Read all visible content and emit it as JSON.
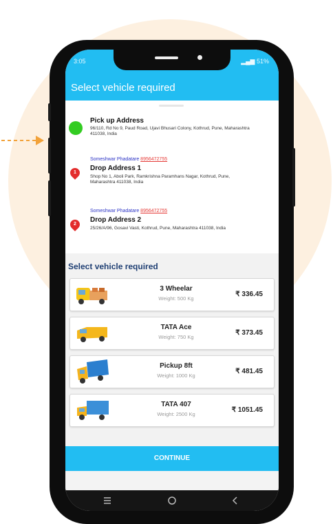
{
  "statusbar": {
    "time": "3:05",
    "battery": "51%"
  },
  "appbar": {
    "title": "Select vehicle required"
  },
  "pickup": {
    "title": "Pick up Address",
    "address": "96/110, Rd No 9, Paud Road, Ujavi Bhusari Colony, Kothrud, Pune, Maharashtra 411038, India"
  },
  "drops": [
    {
      "contact_name": "Someshwar Phadatare",
      "contact_phone": "8956472755",
      "title": "Drop Address 1",
      "address": "Shop No 1, Aboli Park, Ramkrishna Paramhans Nagar, Kothrud, Pune, Maharashtra 411038, India",
      "marker": "1"
    },
    {
      "contact_name": "Someshwar Phadatare",
      "contact_phone": "8956472755",
      "title": "Drop Address 2",
      "address": "25/26/A/96, Gosavi Vasti, Kothrud, Pune, Maharashtra 411038, India",
      "marker": "2"
    }
  ],
  "vehicles_section": {
    "title": "Select vehicle required",
    "vehicles": [
      {
        "name": "3 Wheelar",
        "weight": "Weight: 500 Kg",
        "price": "₹ 336.45",
        "icon": "auto-rickshaw-icon"
      },
      {
        "name": "TATA Ace",
        "weight": "Weight: 750 Kg",
        "price": "₹ 373.45",
        "icon": "mini-truck-icon"
      },
      {
        "name": "Pickup 8ft",
        "weight": "Weight: 1000 Kg",
        "price": "₹ 481.45",
        "icon": "pickup-truck-icon"
      },
      {
        "name": "TATA 407",
        "weight": "Weight: 2500 Kg",
        "price": "₹ 1051.45",
        "icon": "truck-icon"
      }
    ]
  },
  "continue_button": {
    "label": "CONTINUE"
  },
  "colors": {
    "primary": "#22bdf2",
    "background_circle": "#fdf0e0",
    "pickup_dot": "#33cc22",
    "drop_pin": "#e32b2b"
  }
}
